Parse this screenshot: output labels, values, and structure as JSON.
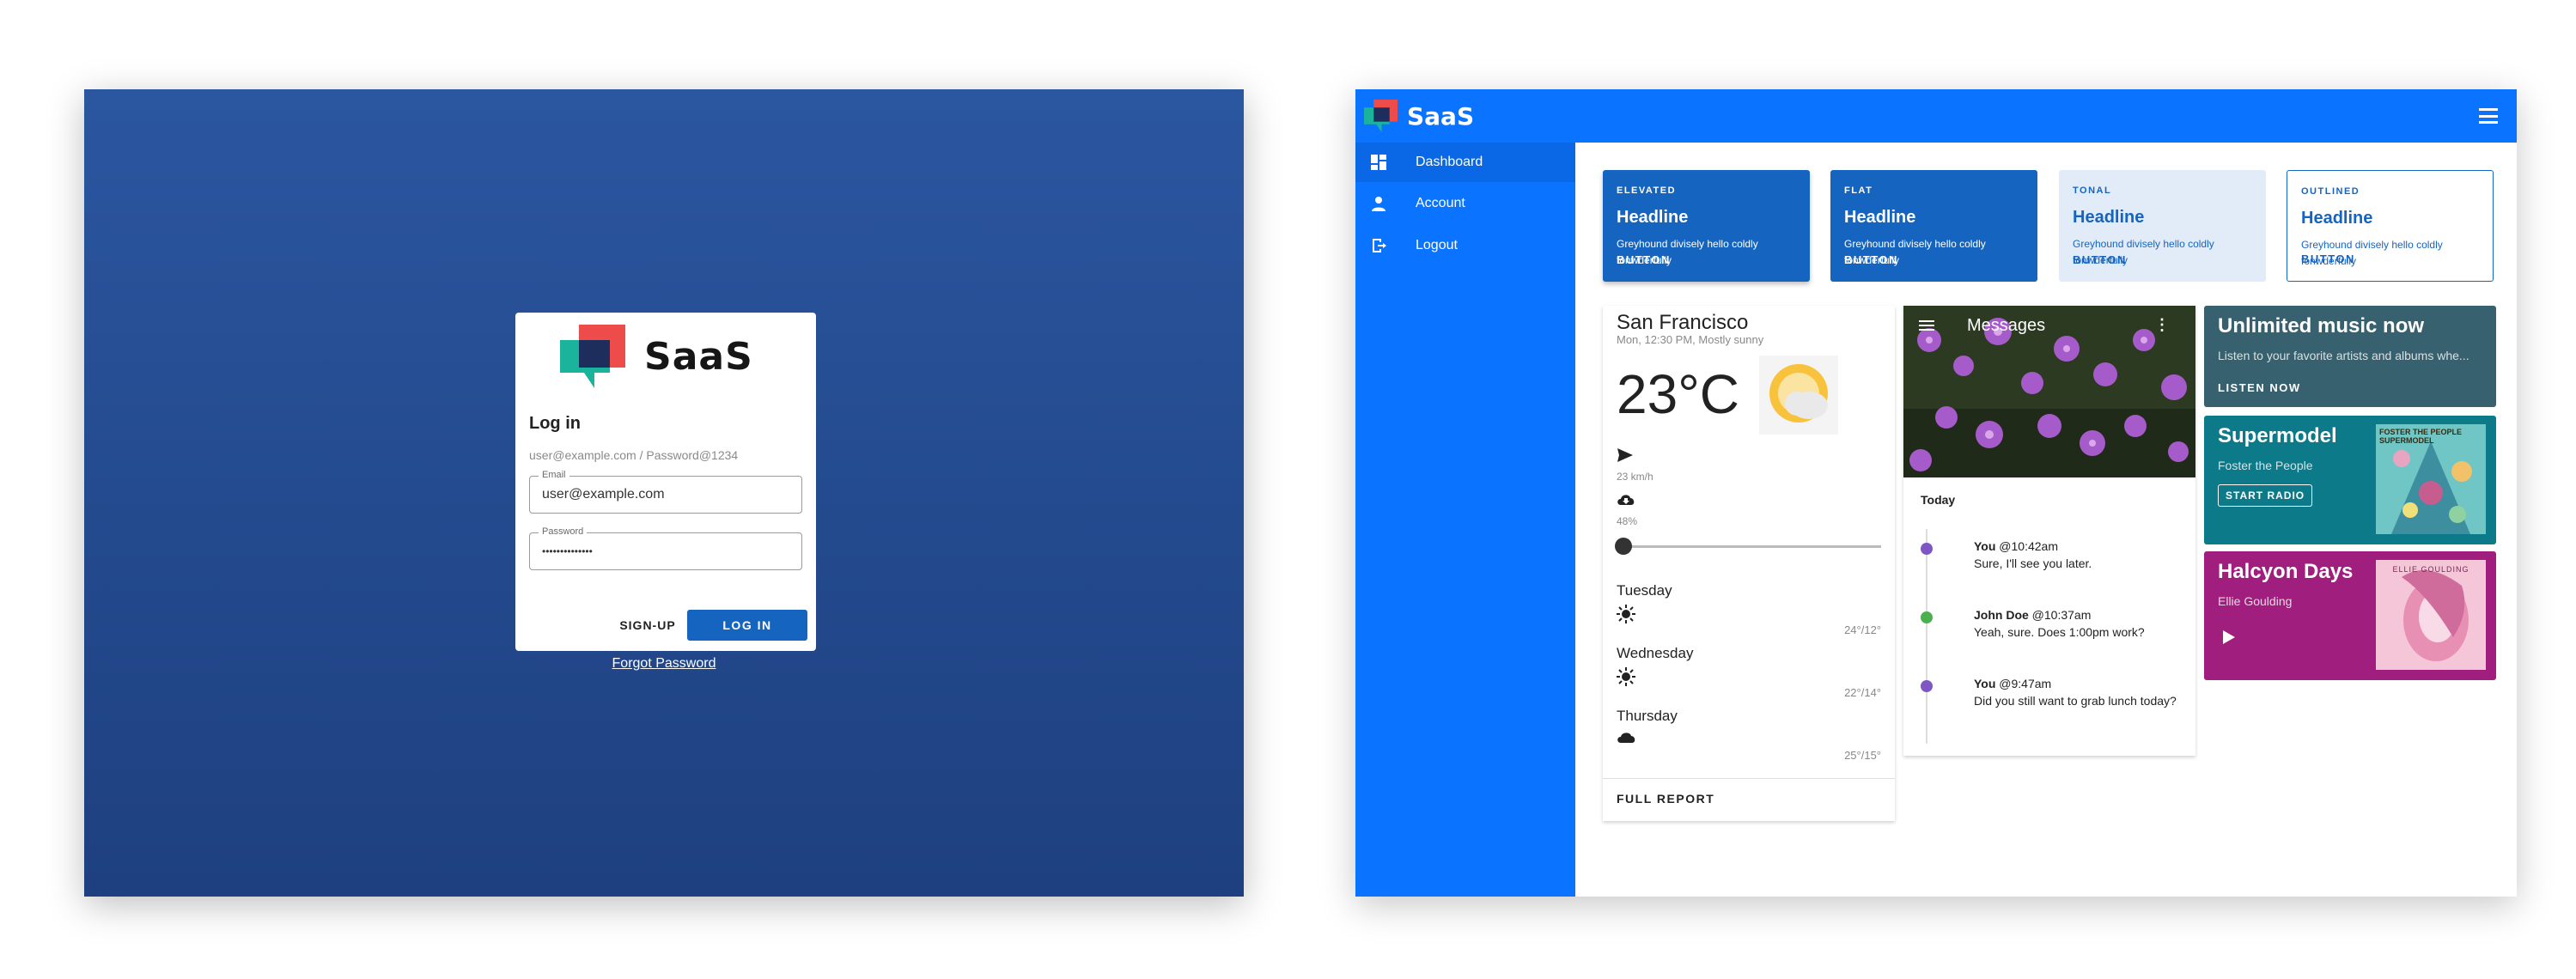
{
  "login": {
    "brand": "SaaS",
    "title": "Log in",
    "hint": "user@example.com / Password@1234",
    "email_label": "Email",
    "email_value": "user@example.com",
    "password_label": "Password",
    "password_value": "••••••••••••••",
    "signup_label": "SIGN-UP",
    "login_label": "LOG IN",
    "forgot_label": "Forgot Password"
  },
  "dashboard": {
    "brand": "SaaS",
    "nav": [
      {
        "label": "Dashboard",
        "icon": "dashboard-icon"
      },
      {
        "label": "Account",
        "icon": "person-icon"
      },
      {
        "label": "Logout",
        "icon": "logout-icon"
      }
    ],
    "cards": [
      {
        "overline": "ELEVATED",
        "headline": "Headline",
        "body": "Greyhound divisely hello coldly fonwderfully",
        "button": "BUTTON"
      },
      {
        "overline": "FLAT",
        "headline": "Headline",
        "body": "Greyhound divisely hello coldly fonwderfully",
        "button": "BUTTON"
      },
      {
        "overline": "TONAL",
        "headline": "Headline",
        "body": "Greyhound divisely hello coldly fonwderfully",
        "button": "BUTTON"
      },
      {
        "overline": "OUTLINED",
        "headline": "Headline",
        "body": "Greyhound divisely hello coldly fonwderfully",
        "button": "BUTTON"
      }
    ],
    "weather": {
      "city": "San Francisco",
      "subtitle": "Mon, 12:30 PM, Mostly sunny",
      "temp": "23°C",
      "wind": "23 km/h",
      "rain": "48%",
      "slider_value": 0,
      "days": [
        {
          "name": "Tuesday",
          "icon": "sun-icon",
          "temp": "24°/12°"
        },
        {
          "name": "Wednesday",
          "icon": "sun-icon",
          "temp": "22°/14°"
        },
        {
          "name": "Thursday",
          "icon": "cloud-icon",
          "temp": "25°/15°"
        }
      ],
      "full_report": "FULL REPORT"
    },
    "messages": {
      "title": "Messages",
      "today": "Today",
      "items": [
        {
          "author": "You",
          "time": "@10:42am",
          "text": "Sure, I'll see you later.",
          "color": "#7e57c2"
        },
        {
          "author": "John Doe",
          "time": "@10:37am",
          "text": "Yeah, sure. Does 1:00pm work?",
          "color": "#4caf50"
        },
        {
          "author": "You",
          "time": "@9:47am",
          "text": "Did you still want to grab lunch today?",
          "color": "#7e57c2"
        }
      ]
    },
    "music": [
      {
        "title": "Unlimited music now",
        "subtitle": "Listen to your favorite artists and albums whe...",
        "button": "LISTEN NOW",
        "color": "#37616e"
      },
      {
        "title": "Supermodel",
        "subtitle": "Foster the People",
        "button": "START RADIO",
        "color": "#0d7a8a",
        "art_text": "FOSTER THE PEOPLE SUPERMODEL"
      },
      {
        "title": "Halcyon Days",
        "subtitle": "Ellie Goulding",
        "color": "#a01f7e",
        "art_text": "ELLIE GOULDING"
      }
    ]
  },
  "colors": {
    "login_bg": "#2b56a0",
    "primary": "#0a73ff",
    "card_blue": "#1565c0"
  }
}
